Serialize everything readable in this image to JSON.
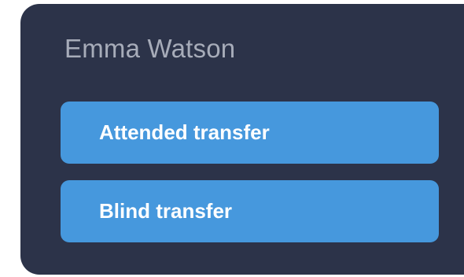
{
  "transfer_menu": {
    "contact_name": "Emma Watson",
    "actions": [
      {
        "label": "Attended transfer"
      },
      {
        "label": "Blind transfer"
      }
    ]
  },
  "colors": {
    "panel_background": "#2c3349",
    "button_background": "#4698dd",
    "name_text": "#a7acb9",
    "button_text": "#ffffff"
  }
}
